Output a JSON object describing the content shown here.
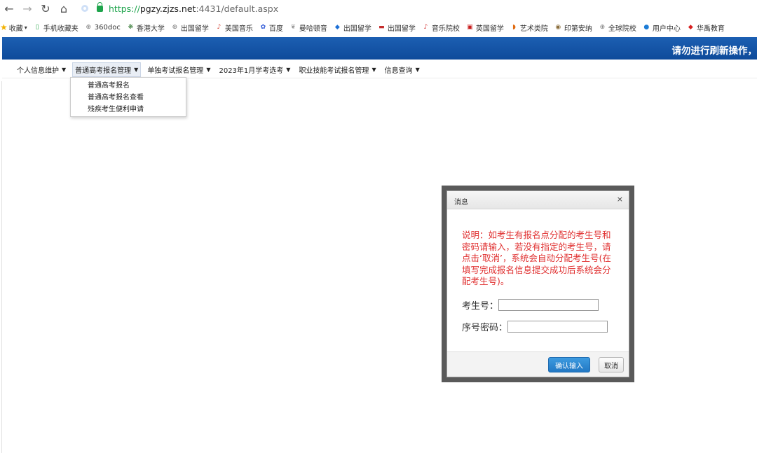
{
  "browser": {
    "url_https": "https://",
    "url_host": "pgzy.zjzs.net",
    "url_rest": ":4431/default.aspx"
  },
  "bookmarks": [
    {
      "label": "收藏",
      "icon": "star-icon",
      "color": "#f2b100"
    },
    {
      "label": "手机收藏夹",
      "icon": "phone-icon",
      "color": "#2fa84f"
    },
    {
      "label": "360doc",
      "icon": "globe-icon",
      "color": "#777777"
    },
    {
      "label": "香港大学",
      "icon": "hku-icon",
      "color": "#3a7d3a"
    },
    {
      "label": "出国留学",
      "icon": "globe-icon",
      "color": "#777777"
    },
    {
      "label": "美国音乐",
      "icon": "music-icon",
      "color": "#d23a2a"
    },
    {
      "label": "百度",
      "icon": "paw-icon",
      "color": "#2d57d6"
    },
    {
      "label": "曼哈顿音",
      "icon": "leaf-icon",
      "color": "#999999"
    },
    {
      "label": "出国留学",
      "icon": "diamond-icon",
      "color": "#1b6fd6"
    },
    {
      "label": "出国留学",
      "icon": "book-icon",
      "color": "#c42c2c"
    },
    {
      "label": "音乐院校",
      "icon": "music-icon",
      "color": "#d02a2a"
    },
    {
      "label": "英国留学",
      "icon": "flag-icon",
      "color": "#c81d1d"
    },
    {
      "label": "艺术类院",
      "icon": "art-icon",
      "color": "#e06a10"
    },
    {
      "label": "印第安纳",
      "icon": "seal-icon",
      "color": "#8a6d3b"
    },
    {
      "label": "全球院校",
      "icon": "globe-icon",
      "color": "#777777"
    },
    {
      "label": "用户中心",
      "icon": "user-icon",
      "color": "#1c7cd6"
    },
    {
      "label": "华禹教育",
      "icon": "diamond-icon",
      "color": "#d82020"
    }
  ],
  "header": {
    "notice": "请勿进行刷新操作，"
  },
  "menu": [
    {
      "label": "个人信息维护"
    },
    {
      "label": "普通高考报名管理"
    },
    {
      "label": "单独考试报名管理"
    },
    {
      "label": "2023年1月学考选考"
    },
    {
      "label": "职业技能考试报名管理"
    },
    {
      "label": "信息查询"
    }
  ],
  "dropdown": [
    {
      "label": "普通高考报名"
    },
    {
      "label": "普通高考报名查看"
    },
    {
      "label": "残疾考生便利申请"
    }
  ],
  "modal": {
    "title": "消息",
    "close": "×",
    "description": "说明：如考生有报名点分配的考生号和密码请输入，若没有指定的考生号，请点击‘取消’，系统会自动分配考生号(在填写完成报名信息提交成功后系统会分配考生号)。",
    "exam_no_label": "考生号：",
    "exam_no_value": "",
    "password_label": "序号密码：",
    "password_value": "",
    "confirm_label": "确认输入",
    "cancel_label": "取消"
  },
  "colors": {
    "header_blue": "#1c5fb2",
    "notice_red": "#e03030",
    "confirm_blue": "#2278c4"
  }
}
